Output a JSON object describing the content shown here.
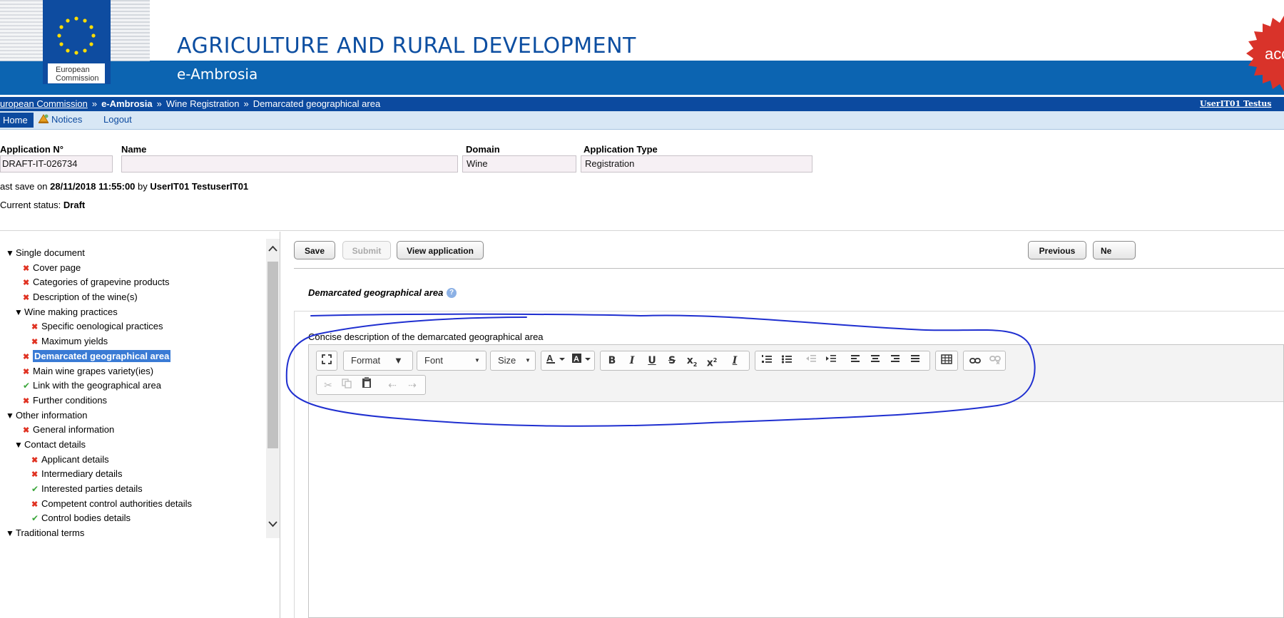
{
  "banner": {
    "logo_line1": "European",
    "logo_line2": "Commission",
    "dg_title": "AGRICULTURE AND RURAL DEVELOPMENT",
    "app_name": "e-Ambrosia",
    "seal_text": "acc",
    "seal_color": "#d9332a"
  },
  "breadcrumb": {
    "items": [
      "uropean Commission",
      "e-Ambrosia",
      "Wine Registration",
      "Demarcated geographical area"
    ],
    "separator": "»",
    "user": "UserIT01 Testus"
  },
  "menu": {
    "home": "Home",
    "notices": "Notices",
    "logout": "Logout"
  },
  "application": {
    "number_label": "Application N°",
    "number_value": "DRAFT-IT-026734",
    "name_label": "Name",
    "name_value": "",
    "domain_label": "Domain",
    "domain_value": "Wine",
    "type_label": "Application Type",
    "type_value": "Registration",
    "last_save_prefix": "ast save on",
    "last_save_datetime": "28/11/2018 11:55:00",
    "last_save_by": "by",
    "last_save_user": "UserIT01 TestuserIT01",
    "status_label": "Current status:",
    "status_value": "Draft"
  },
  "tree": [
    {
      "label": "Single document",
      "status": "open",
      "level": 1
    },
    {
      "label": "Cover page",
      "status": "error",
      "level": 2
    },
    {
      "label": "Categories of grapevine products",
      "status": "error",
      "level": 2
    },
    {
      "label": "Description of the wine(s)",
      "status": "error",
      "level": 2
    },
    {
      "label": "Wine making practices",
      "status": "open",
      "level": "2b"
    },
    {
      "label": "Specific oenological practices",
      "status": "error",
      "level": 3
    },
    {
      "label": "Maximum yields",
      "status": "error",
      "level": 3
    },
    {
      "label": "Demarcated geographical area",
      "status": "error",
      "level": 2,
      "selected": true
    },
    {
      "label": "Main wine grapes variety(ies)",
      "status": "error",
      "level": 2
    },
    {
      "label": "Link with the geographical area",
      "status": "ok",
      "level": 2
    },
    {
      "label": "Further conditions",
      "status": "error",
      "level": 2
    },
    {
      "label": "Other information",
      "status": "open",
      "level": 1
    },
    {
      "label": "General information",
      "status": "error",
      "level": 2
    },
    {
      "label": "Contact details",
      "status": "open",
      "level": "2b"
    },
    {
      "label": "Applicant details",
      "status": "error",
      "level": 3
    },
    {
      "label": "Intermediary details",
      "status": "error",
      "level": 3
    },
    {
      "label": "Interested parties details",
      "status": "ok",
      "level": 3
    },
    {
      "label": "Competent control authorities details",
      "status": "error",
      "level": 3
    },
    {
      "label": "Control bodies details",
      "status": "ok",
      "level": 3
    },
    {
      "label": "Traditional terms",
      "status": "open",
      "level": 1
    }
  ],
  "actions": {
    "save": "Save",
    "submit": "Submit",
    "view": "View application",
    "previous": "Previous",
    "next": "Ne"
  },
  "section": {
    "title": "Demarcated geographical area",
    "help": "?",
    "field_label": "oncise description of the demarcated geographical area"
  },
  "editor": {
    "format": "Format",
    "font": "Font",
    "size": "Size"
  },
  "colors": {
    "band": "#0c64b1",
    "breadcrumb_bg": "#0c4a9f",
    "menu_bg": "#d8e7f5",
    "error": "#e03222",
    "ok": "#3aa63a",
    "selected_bg": "#3a7bd5",
    "annotation": "#1f2fd0"
  }
}
